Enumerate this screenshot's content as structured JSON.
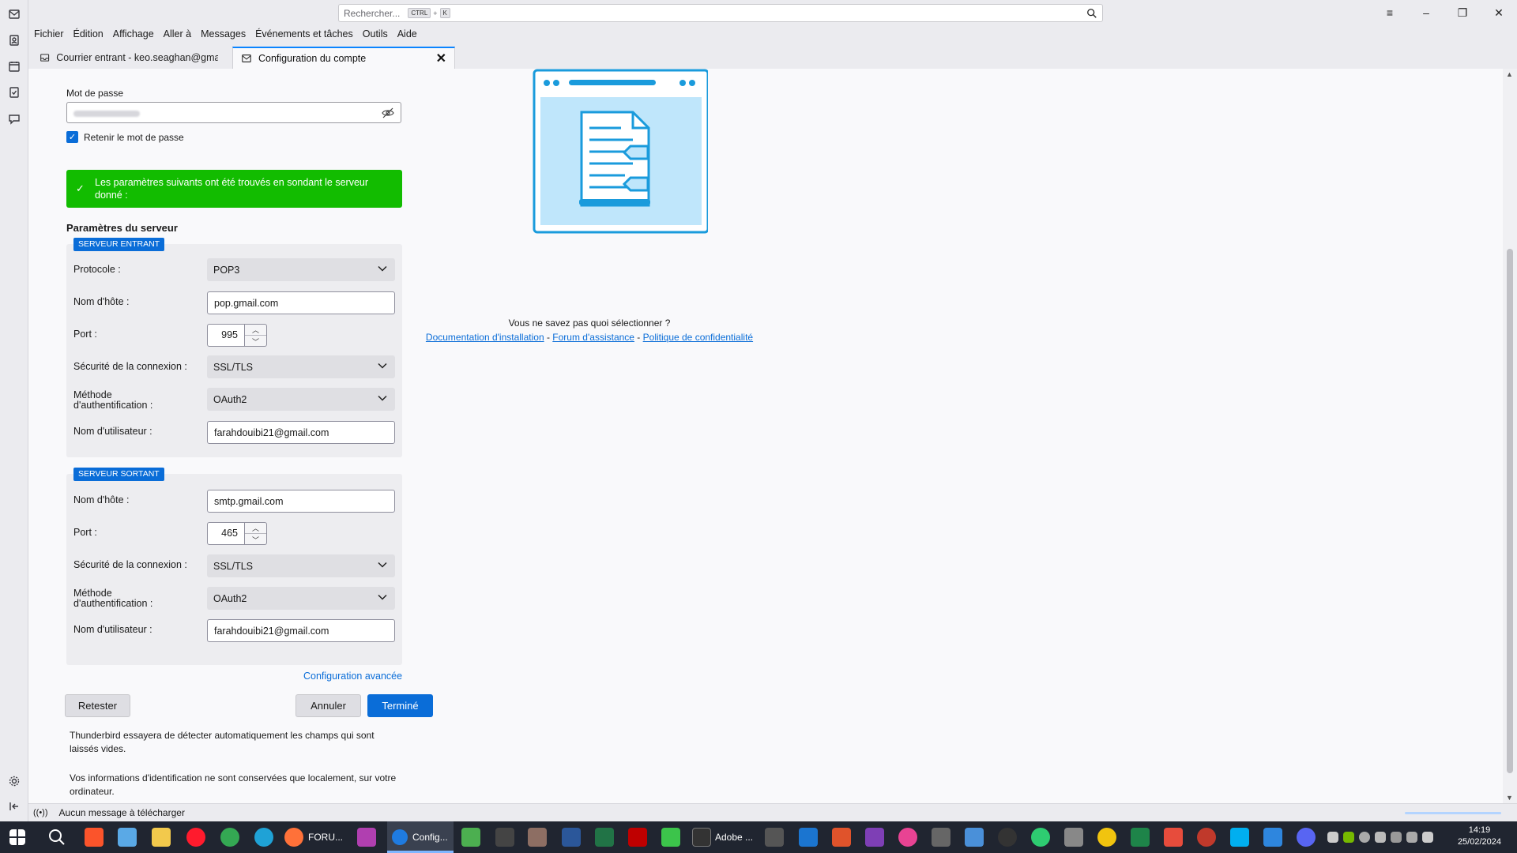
{
  "search": {
    "placeholder": "Rechercher...",
    "kbd_ctrl": "CTRL",
    "kbd_plus": "+",
    "kbd_key": "K"
  },
  "menu": [
    "Fichier",
    "Édition",
    "Affichage",
    "Aller à",
    "Messages",
    "Événements et tâches",
    "Outils",
    "Aide"
  ],
  "tabs": {
    "inbox": "Courrier entrant - keo.seaghan@gmail.",
    "config": "Configuration du compte"
  },
  "form": {
    "password_label": "Mot de passe",
    "remember_label": "Retenir le mot de passe",
    "remember_checked": true,
    "notice": "Les paramètres suivants ont été trouvés en sondant le serveur donné :",
    "server_settings_title": "Paramètres du serveur",
    "incoming": {
      "badge": "SERVEUR ENTRANT",
      "protocol_label": "Protocole :",
      "protocol_value": "POP3",
      "hostname_label": "Nom d'hôte :",
      "hostname_value": "pop.gmail.com",
      "port_label": "Port :",
      "port_value": "995",
      "security_label": "Sécurité de la connexion :",
      "security_value": "SSL/TLS",
      "auth_label_1": "Méthode",
      "auth_label_2": "d'authentification :",
      "auth_value": "OAuth2",
      "username_label": "Nom d'utilisateur :",
      "username_value": "farahdouibi21@gmail.com"
    },
    "outgoing": {
      "badge": "SERVEUR SORTANT",
      "hostname_label": "Nom d'hôte :",
      "hostname_value": "smtp.gmail.com",
      "port_label": "Port :",
      "port_value": "465",
      "security_label": "Sécurité de la connexion :",
      "security_value": "SSL/TLS",
      "auth_label_1": "Méthode",
      "auth_label_2": "d'authentification :",
      "auth_value": "OAuth2",
      "username_label": "Nom d'utilisateur :",
      "username_value": "farahdouibi21@gmail.com"
    },
    "advanced_link": "Configuration avancée",
    "retest_button": "Retester",
    "cancel_button": "Annuler",
    "done_button": "Terminé",
    "help_1": "Thunderbird essayera de détecter automatiquement les champs qui sont laissés vides.",
    "help_2": "Vos informations d'identification ne sont conservées que localement, sur votre ordinateur."
  },
  "side": {
    "question": "Vous ne savez pas quoi sélectionner ?",
    "link_docs": "Documentation d'installation",
    "sep": " - ",
    "link_forum": "Forum d'assistance",
    "link_privacy": "Politique de confidentialité"
  },
  "status": {
    "text": "Aucun message à télécharger"
  },
  "taskbar": {
    "firefox_label": "FORU...",
    "thunderbird_label": "Config...",
    "adobe_label": "Adobe ...",
    "time": "14:19",
    "date": "25/02/2024"
  },
  "colors": {
    "accent": "#0a6dd8",
    "success": "#12bc00",
    "taskbar": "#202530"
  }
}
